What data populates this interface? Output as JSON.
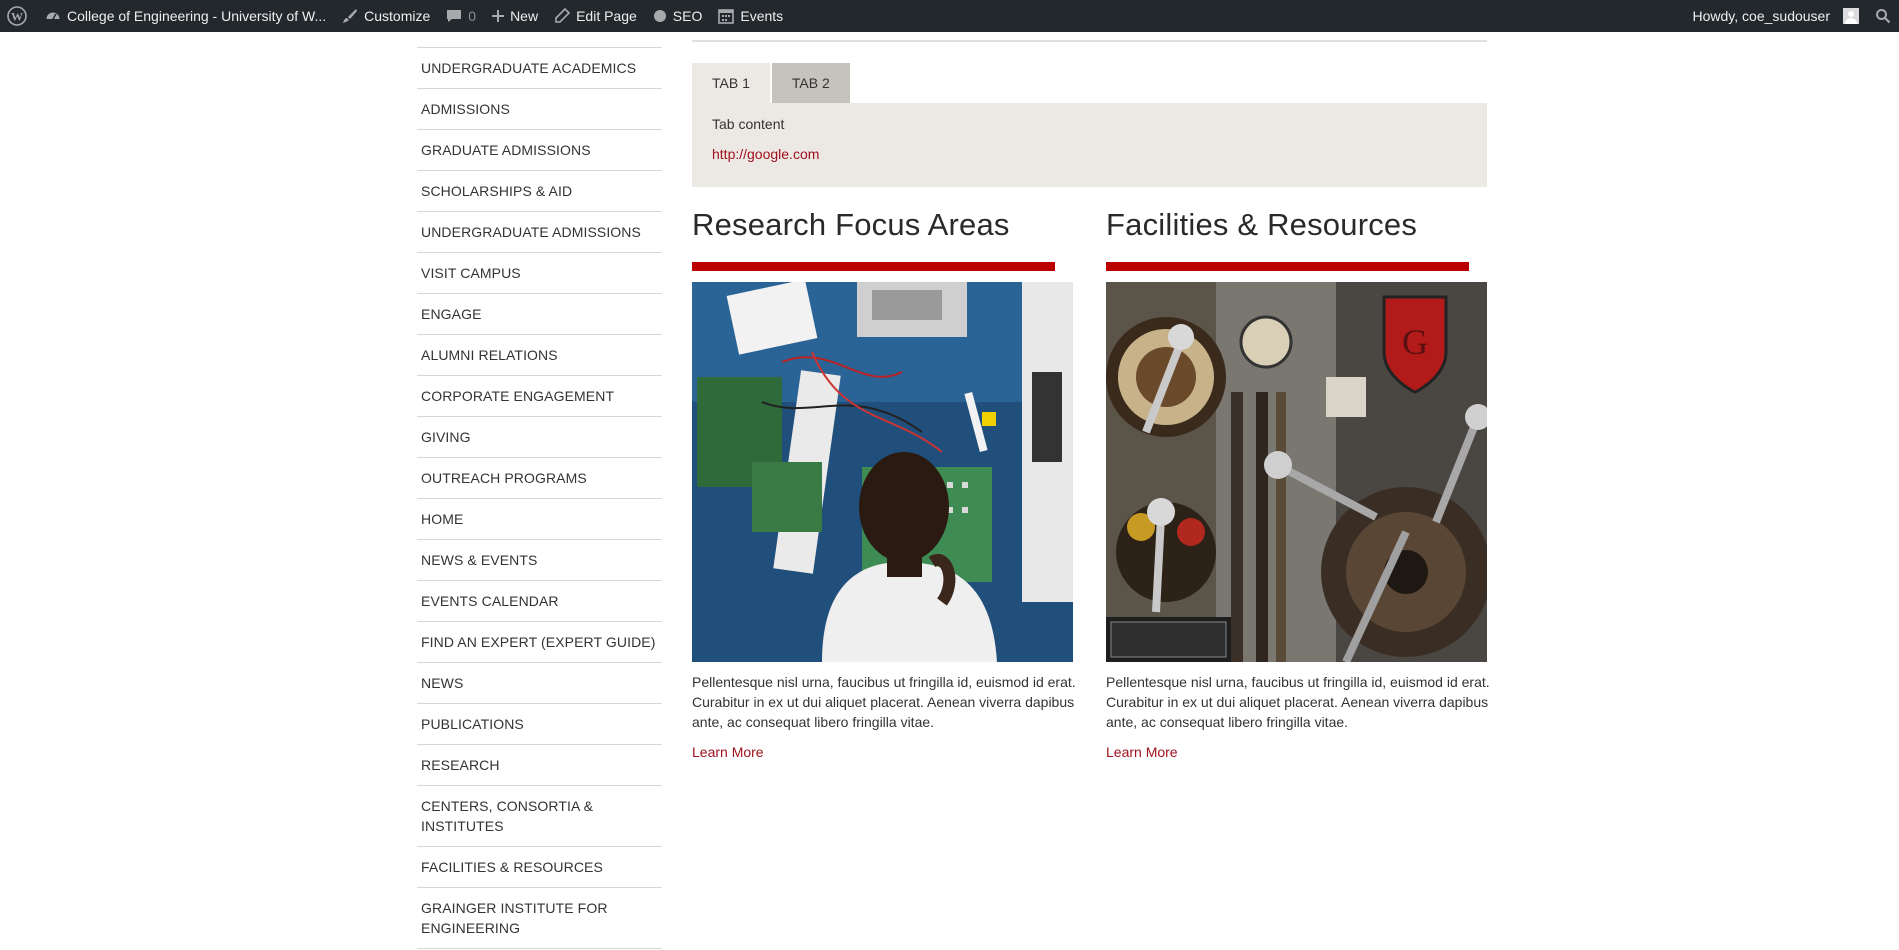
{
  "adminbar": {
    "site_name": "College of Engineering - University of W...",
    "customize": "Customize",
    "comments_count": "0",
    "new": "New",
    "edit_page": "Edit Page",
    "seo": "SEO",
    "events": "Events",
    "howdy": "Howdy, coe_sudouser"
  },
  "sidebar": {
    "items": [
      {
        "label": "UNDERGRADUATE ACADEMICS"
      },
      {
        "label": "ADMISSIONS"
      },
      {
        "label": "GRADUATE ADMISSIONS"
      },
      {
        "label": "SCHOLARSHIPS & AID"
      },
      {
        "label": "UNDERGRADUATE ADMISSIONS"
      },
      {
        "label": "VISIT CAMPUS"
      },
      {
        "label": "ENGAGE"
      },
      {
        "label": "ALUMNI RELATIONS"
      },
      {
        "label": "CORPORATE ENGAGEMENT"
      },
      {
        "label": "GIVING"
      },
      {
        "label": "OUTREACH PROGRAMS"
      },
      {
        "label": "HOME"
      },
      {
        "label": "NEWS & EVENTS"
      },
      {
        "label": "EVENTS CALENDAR"
      },
      {
        "label": "FIND AN EXPERT (EXPERT GUIDE)"
      },
      {
        "label": "NEWS"
      },
      {
        "label": "PUBLICATIONS"
      },
      {
        "label": "RESEARCH"
      },
      {
        "label": "CENTERS, CONSORTIA & INSTITUTES"
      },
      {
        "label": "FACILITIES & RESOURCES"
      },
      {
        "label": "GRAINGER INSTITUTE FOR ENGINEERING"
      }
    ]
  },
  "tabs": {
    "items": [
      {
        "label": "TAB 1"
      },
      {
        "label": "TAB 2"
      }
    ],
    "panel_text": "Tab content",
    "panel_link": "http://google.com"
  },
  "columns": [
    {
      "title": "Research Focus Areas",
      "text": "Pellentesque nisl urna, faucibus ut fringilla id, euismod id erat. Curabitur in ex ut dui aliquet placerat. Aenean viverra dapibus ante, ac consequat libero fringilla vitae.",
      "link": "Learn More"
    },
    {
      "title": "Facilities & Resources",
      "text": "Pellentesque nisl urna, faucibus ut fringilla id, euismod id erat. Curabitur in ex ut dui aliquet placerat. Aenean viverra dapibus ante, ac consequat libero fringilla vitae.",
      "link": "Learn More"
    }
  ],
  "colors": {
    "adminbar_bg": "#23282d",
    "accent_red": "#bb0000",
    "link_red": "#a0111d",
    "tab_panel_bg": "#ece9e4"
  }
}
